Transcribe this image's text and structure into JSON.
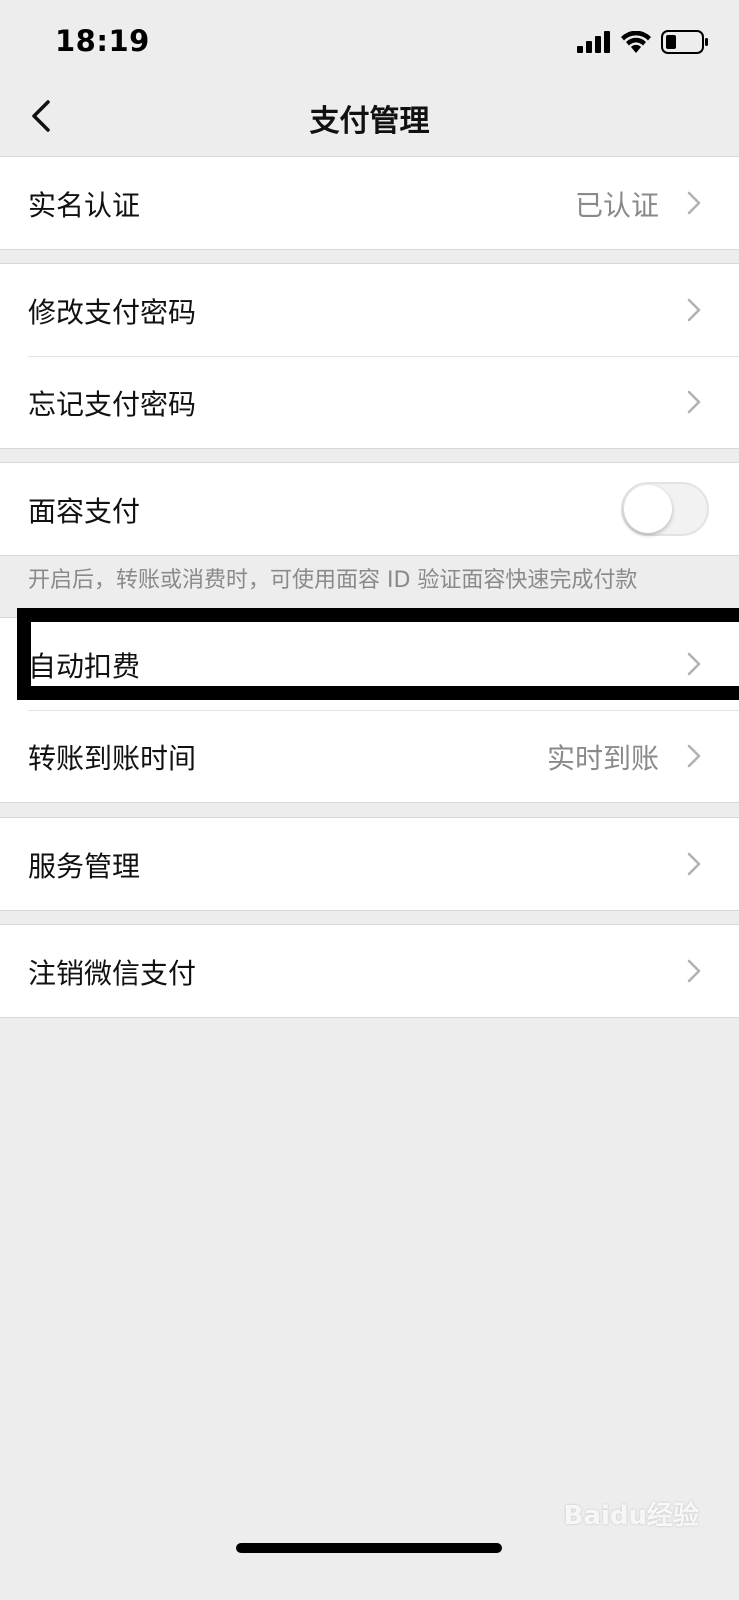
{
  "status_bar": {
    "time": "18:19",
    "icons": [
      "signal-icon",
      "wifi-icon",
      "battery-icon"
    ]
  },
  "nav": {
    "back_icon": "chevron-left-icon",
    "title": "支付管理"
  },
  "groups": {
    "identity": {
      "label": "实名认证",
      "value": "已认证"
    },
    "password": {
      "change_label": "修改支付密码",
      "forgot_label": "忘记支付密码"
    },
    "face_pay": {
      "label": "面容支付",
      "enabled": false,
      "hint": "开启后，转账或消费时，可使用面容 ID 验证面容快速完成付款"
    },
    "payments": {
      "auto_deduct_label": "自动扣费",
      "transfer_time_label": "转账到账时间",
      "transfer_time_value": "实时到账"
    },
    "service": {
      "label": "服务管理"
    },
    "cancel": {
      "label": "注销微信支付"
    }
  },
  "watermark": "Baidu经验",
  "colors": {
    "background": "#ededed",
    "cell_background": "#ffffff",
    "secondary_text": "#8a8a8a",
    "highlight": "#000000"
  }
}
